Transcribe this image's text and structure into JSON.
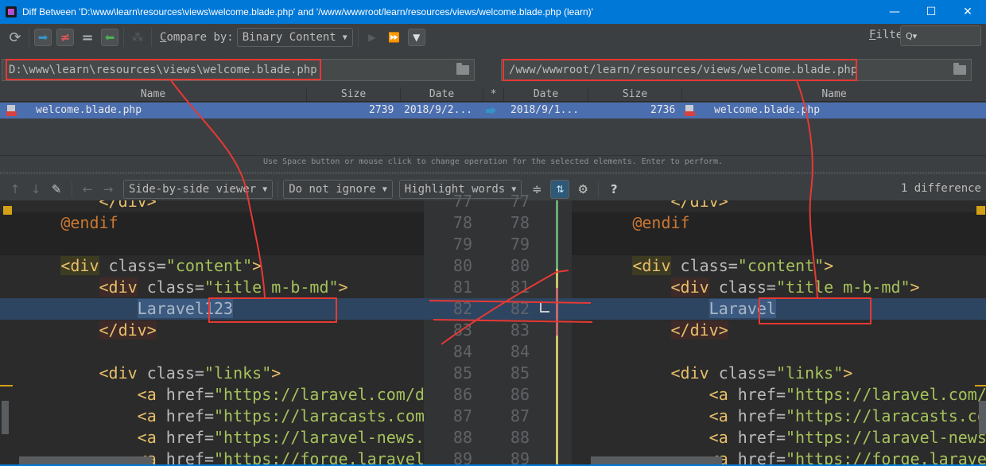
{
  "window": {
    "title": "Diff Between 'D:\\www\\learn\\resources\\views\\welcome.blade.php' and '/www/wwwroot/learn/resources/views/welcome.blade.php (learn)'",
    "minimize": "—",
    "maximize": "☐",
    "close": "✕"
  },
  "toolbar": {
    "refresh_icon": "⟳",
    "copy_right_icon": "➡",
    "not_equal_icon": "≠",
    "equal_icon": "=",
    "copy_left_icon": "⬅",
    "exclude_icon": "⁂",
    "compare_by_label_prefix": "C",
    "compare_by_label_rest": "ompare by:",
    "compare_by_value": "Binary Content",
    "step_icon": "▶",
    "fast_forward_icon": "⏩",
    "filter_icon": "▼",
    "filter_label_prefix": "F",
    "filter_label_rest": "ilter:",
    "filter_search_icon": "🔍▾",
    "filter_value": ""
  },
  "paths": {
    "left": "D:\\www\\learn\\resources\\views\\welcome.blade.php",
    "right": "/www/wwwroot/learn/resources/views/welcome.blade.php"
  },
  "table": {
    "headers": [
      "Name",
      "Size",
      "Date",
      "*",
      "Date",
      "Size",
      "Name"
    ],
    "rows": [
      {
        "left_name": "welcome.blade.php",
        "left_size": "2739",
        "left_date": "2018/9/2...",
        "operation": "copy-right",
        "right_date": "2018/9/1...",
        "right_size": "2736",
        "right_name": "welcome.blade.php"
      }
    ]
  },
  "hint": "Use Space button or mouse click to change operation for the selected elements. Enter to perform.",
  "diff_toolbar": {
    "prev_icon": "↑",
    "next_icon": "↓",
    "edit_icon": "✎",
    "back_icon": "←",
    "forward_icon": "→",
    "viewer": "Side-by-side viewer",
    "ignore": "Do not ignore",
    "highlight": "Highlight words",
    "collapse_icon": "≑",
    "sync_scroll_icon": "⇅",
    "settings_icon": "⚙",
    "help_icon": "?",
    "difference_count": "1 difference"
  },
  "editor": {
    "line_numbers": [
      "77",
      "78",
      "79",
      "80",
      "81",
      "82",
      "83",
      "84",
      "85",
      "86",
      "87",
      "88",
      "89"
    ],
    "highlighted_line": "82",
    "left": {
      "changed_text": "Laravel123",
      "lines": [
        {
          "indent": "            ",
          "parts": [
            [
              "tag",
              "</div>"
            ]
          ]
        },
        {
          "indent": "        ",
          "parts": [
            [
              "kw",
              "@endif"
            ]
          ]
        },
        {
          "indent": "",
          "parts": []
        },
        {
          "indent": "        ",
          "parts": [
            [
              "tag",
              "<div"
            ],
            [
              "attr",
              " class="
            ],
            [
              "str",
              "\"content\""
            ],
            [
              "tag",
              ">"
            ]
          ]
        },
        {
          "indent": "            ",
          "parts": [
            [
              "tag",
              "<div"
            ],
            [
              "attr",
              " class="
            ],
            [
              "str",
              "\"title m-b-md\""
            ],
            [
              "tag",
              ">"
            ]
          ]
        },
        {
          "indent": "                ",
          "parts": [
            [
              "word",
              "Laravel123"
            ]
          ]
        },
        {
          "indent": "            ",
          "parts": [
            [
              "tag",
              "</div>"
            ]
          ]
        },
        {
          "indent": "",
          "parts": []
        },
        {
          "indent": "            ",
          "parts": [
            [
              "tag",
              "<div"
            ],
            [
              "attr",
              " class="
            ],
            [
              "str",
              "\"links\""
            ],
            [
              "tag",
              ">"
            ]
          ]
        },
        {
          "indent": "                ",
          "parts": [
            [
              "tag",
              "<a"
            ],
            [
              "attr",
              " href="
            ],
            [
              "str",
              "\"https://laravel.com/docs\""
            ]
          ]
        },
        {
          "indent": "                ",
          "parts": [
            [
              "tag",
              "<a"
            ],
            [
              "attr",
              " href="
            ],
            [
              "str",
              "\"https://laracasts.com\""
            ]
          ]
        },
        {
          "indent": "                ",
          "parts": [
            [
              "tag",
              "<a"
            ],
            [
              "attr",
              " href="
            ],
            [
              "str",
              "\"https://laravel-news.com\""
            ]
          ]
        },
        {
          "indent": "                ",
          "parts": [
            [
              "tag",
              "<a"
            ],
            [
              "attr",
              " href="
            ],
            [
              "str",
              "\"https://forge.laravel.com\""
            ]
          ]
        }
      ]
    },
    "right": {
      "changed_text": "Laravel",
      "lines": [
        {
          "indent": "            ",
          "parts": [
            [
              "tag",
              "</div>"
            ]
          ]
        },
        {
          "indent": "        ",
          "parts": [
            [
              "kw",
              "@endif"
            ]
          ]
        },
        {
          "indent": "",
          "parts": []
        },
        {
          "indent": "        ",
          "parts": [
            [
              "tag",
              "<div"
            ],
            [
              "attr",
              " class="
            ],
            [
              "str",
              "\"content\""
            ],
            [
              "tag",
              ">"
            ]
          ]
        },
        {
          "indent": "            ",
          "parts": [
            [
              "tag",
              "<div"
            ],
            [
              "attr",
              " class="
            ],
            [
              "str",
              "\"title m-b-md\""
            ],
            [
              "tag",
              ">"
            ]
          ]
        },
        {
          "indent": "                ",
          "parts": [
            [
              "word",
              "Laravel"
            ]
          ]
        },
        {
          "indent": "            ",
          "parts": [
            [
              "tag",
              "</div>"
            ]
          ]
        },
        {
          "indent": "",
          "parts": []
        },
        {
          "indent": "            ",
          "parts": [
            [
              "tag",
              "<div"
            ],
            [
              "attr",
              " class="
            ],
            [
              "str",
              "\"links\""
            ],
            [
              "tag",
              ">"
            ]
          ]
        },
        {
          "indent": "                ",
          "parts": [
            [
              "tag",
              "<a"
            ],
            [
              "attr",
              " href="
            ],
            [
              "str",
              "\"https://laravel.com/docs\""
            ]
          ]
        },
        {
          "indent": "                ",
          "parts": [
            [
              "tag",
              "<a"
            ],
            [
              "attr",
              " href="
            ],
            [
              "str",
              "\"https://laracasts.com\""
            ]
          ]
        },
        {
          "indent": "                ",
          "parts": [
            [
              "tag",
              "<a"
            ],
            [
              "attr",
              " href="
            ],
            [
              "str",
              "\"https://laravel-news.com\""
            ]
          ]
        },
        {
          "indent": "                ",
          "parts": [
            [
              "tag",
              "<a"
            ],
            [
              "attr",
              " href="
            ],
            [
              "str",
              "\"https://forge.laravel.com\""
            ]
          ]
        }
      ]
    }
  },
  "colors": {
    "titlebar": "#0078d7",
    "selection_row": "#4b6eaf",
    "annotation_red": "#e53935",
    "changed_line": "#2d4560"
  }
}
